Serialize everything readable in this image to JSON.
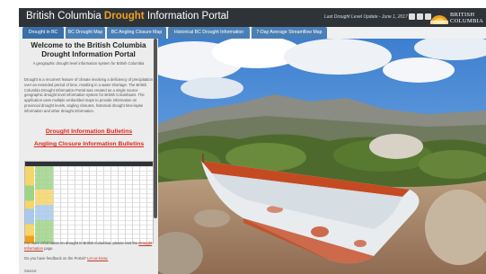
{
  "header": {
    "title_prefix": "British Columbia ",
    "title_highlight": "Drought",
    "title_suffix": " Information Portal",
    "last_update": "Last Drought Level Update - June 1, 2017",
    "logo_text_line1": "BRITISH",
    "logo_text_line2": "COLUMBIA",
    "social_icons": [
      "facebook-icon",
      "twitter-icon",
      "share-icon"
    ]
  },
  "tabs": [
    {
      "label": "Drought in BC",
      "active": true
    },
    {
      "label": "BC Drought Map",
      "active": false
    },
    {
      "label": "BC Angling Closure Map",
      "active": false
    },
    {
      "label": "Historical BC Drought Information",
      "active": false
    },
    {
      "label": "7-Day Average Streamflow Map",
      "active": false
    }
  ],
  "sidebar": {
    "title": "Welcome to the British Columbia Drought Information Portal",
    "subtitle": "A geographic drought level information system for British Columbia",
    "intro": "Drought is a recurrent feature of climate involving a deficiency of precipitation over an extended period of time, resulting in a water shortage. The British Columbia Drought Information Portal was created as a single source geographic drought level information system for British Columbians. The application uses multiple embedded maps to provide information on provincial drought levels, angling closures, historical drought time-lapse information and other drought information.",
    "link_bulletins": "Drought Information Bulletins",
    "link_angling": "Angling Closure Information Bulletins",
    "footer_more_prefix": "For more information on drought in British Columbia, please visit the ",
    "footer_more_link": "Drought Information",
    "footer_more_suffix": " page.",
    "footer_feedback_prefix": "Do you have feedback on the Portal? ",
    "footer_feedback_link": "Let us know.",
    "footer_source": "Source:"
  },
  "colors": {
    "header_bg": "#2e3338",
    "title_highlight": "#f0a020",
    "tab_bg": "#4a7fb5",
    "link_red": "#d9261c",
    "sidebar_bg": "#ececec"
  }
}
